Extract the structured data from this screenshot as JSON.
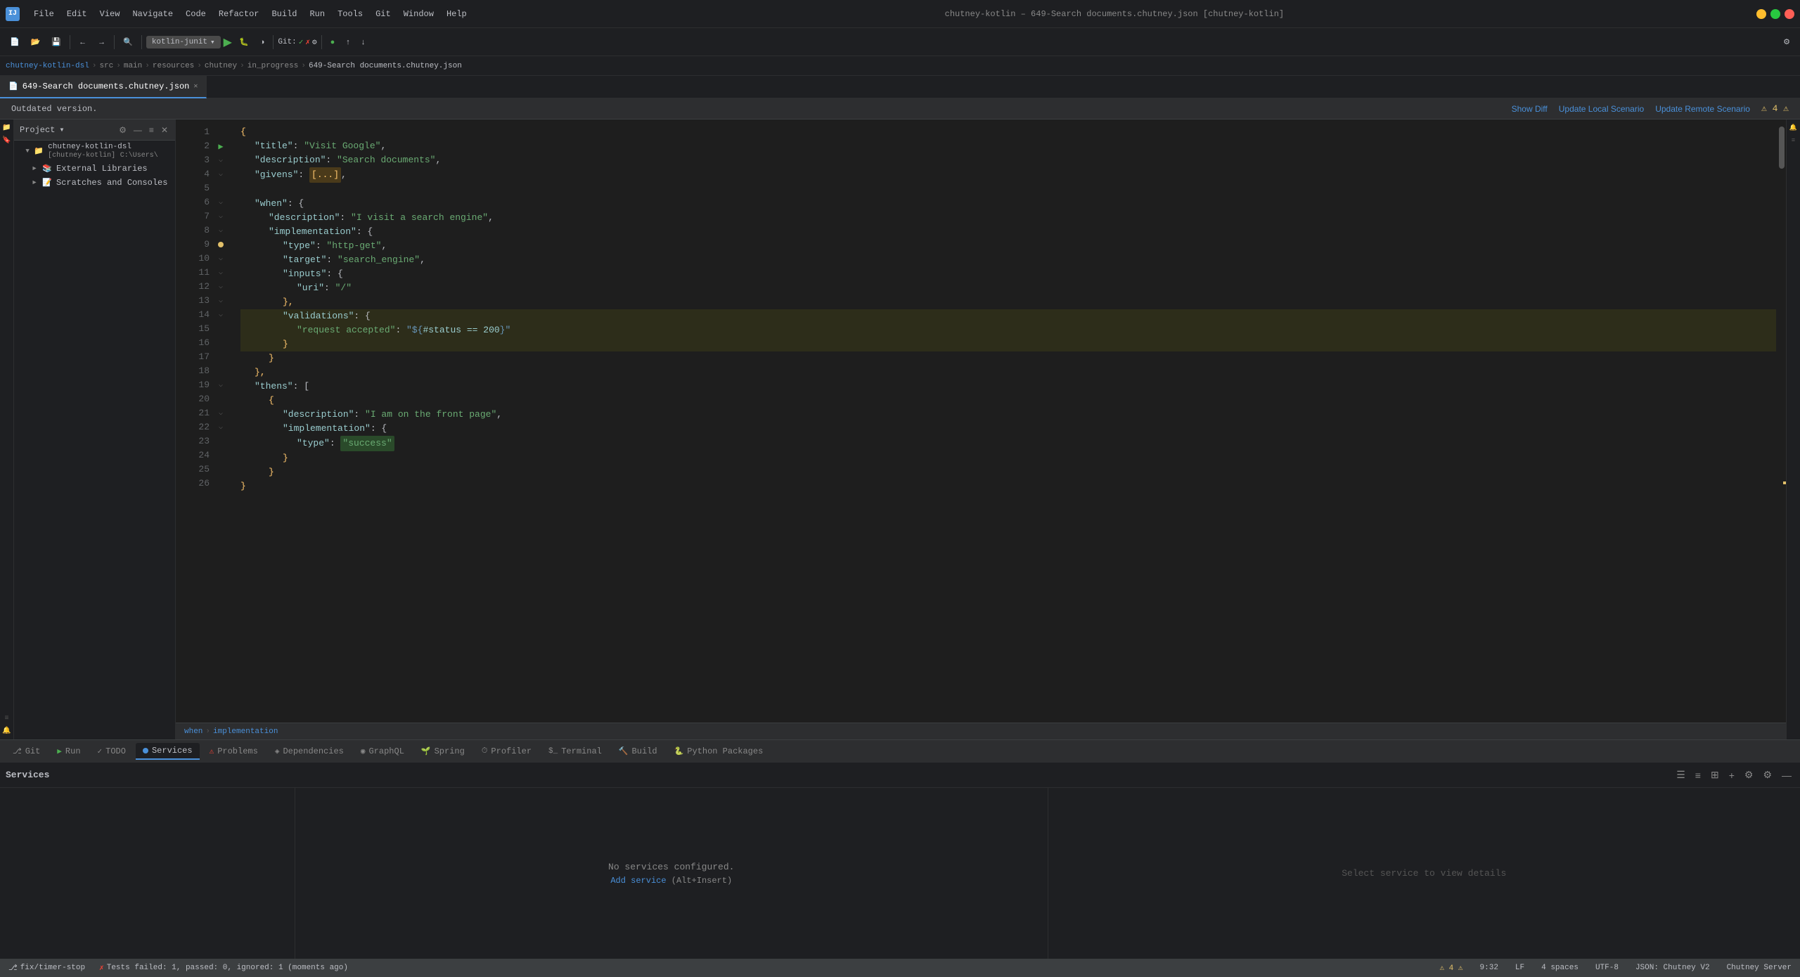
{
  "app": {
    "title": "chutney-kotlin – 649-Search documents.chutney.json [chutney-kotlin]",
    "icon_label": "IJ"
  },
  "title_bar": {
    "menu_items": [
      "File",
      "Edit",
      "View",
      "Navigate",
      "Code",
      "Refactor",
      "Build",
      "Run",
      "Tools",
      "Git",
      "Window",
      "Help"
    ]
  },
  "toolbar": {
    "project_dropdown": "chutney-kotlin-dsl",
    "run_config": "kotlin-junit",
    "git_label": "Git:",
    "git_check": "✓",
    "git_x": "✗"
  },
  "breadcrumb": {
    "parts": [
      "chutney-kotlin-dsl",
      "src",
      "main",
      "resources",
      "chutney",
      "in_progress",
      "649-Search documents.chutney.json"
    ]
  },
  "tabs": {
    "active": "649-Search documents.chutney.json"
  },
  "outdated_banner": {
    "text": "Outdated version.",
    "show_diff": "Show Diff",
    "update_local": "Update Local Scenario",
    "update_remote": "Update Remote Scenario",
    "warning": "⚠ 4 ⚠"
  },
  "sidebar": {
    "header": "Project",
    "items": [
      {
        "label": "chutney-kotlin-dsl [chutney-kotlin]",
        "path": "C:\\Users\\"
      },
      {
        "label": "External Libraries"
      },
      {
        "label": "Scratches and Consoles"
      }
    ]
  },
  "editor": {
    "lines": [
      {
        "num": 1,
        "indent": 0,
        "content": [
          {
            "t": "brace",
            "v": "{"
          }
        ],
        "fold": false
      },
      {
        "num": 2,
        "indent": 1,
        "content": [
          {
            "t": "key",
            "v": "\"title\""
          },
          {
            "t": "default",
            "v": ": "
          },
          {
            "t": "str",
            "v": "\"Visit Google\""
          }
        ],
        "arrow": true
      },
      {
        "num": 3,
        "indent": 1,
        "content": [
          {
            "t": "key",
            "v": "\"description\""
          },
          {
            "t": "default",
            "v": ": "
          },
          {
            "t": "str",
            "v": "\"Search documents\""
          }
        ]
      },
      {
        "num": 4,
        "indent": 1,
        "content": [
          {
            "t": "key",
            "v": "\"givens\""
          },
          {
            "t": "default",
            "v": ": "
          },
          {
            "t": "dots",
            "v": "[...]"
          }
        ]
      },
      {
        "num": 5,
        "indent": 0,
        "content": []
      },
      {
        "num": 6,
        "indent": 1,
        "content": [
          {
            "t": "key",
            "v": "\"when\""
          },
          {
            "t": "default",
            "v": ": {"
          }
        ],
        "fold": true
      },
      {
        "num": 7,
        "indent": 2,
        "content": [
          {
            "t": "key",
            "v": "\"description\""
          },
          {
            "t": "default",
            "v": ": "
          },
          {
            "t": "str",
            "v": "\"I visit a search engine\""
          }
        ]
      },
      {
        "num": 8,
        "indent": 2,
        "content": [
          {
            "t": "key",
            "v": "\"implementation\""
          },
          {
            "t": "default",
            "v": ": {"
          }
        ],
        "fold": true
      },
      {
        "num": 9,
        "indent": 3,
        "content": [
          {
            "t": "key",
            "v": "\"type\""
          },
          {
            "t": "default",
            "v": ": "
          },
          {
            "t": "str",
            "v": "\"http-get\""
          }
        ],
        "dot": true
      },
      {
        "num": 10,
        "indent": 3,
        "content": [
          {
            "t": "key",
            "v": "\"target\""
          },
          {
            "t": "default",
            "v": ": "
          },
          {
            "t": "str",
            "v": "\"search_engine\""
          }
        ]
      },
      {
        "num": 11,
        "indent": 3,
        "content": [
          {
            "t": "key",
            "v": "\"inputs\""
          },
          {
            "t": "default",
            "v": ": {"
          }
        ],
        "fold": true
      },
      {
        "num": 12,
        "indent": 4,
        "content": [
          {
            "t": "key",
            "v": "\"uri\""
          },
          {
            "t": "default",
            "v": ": "
          },
          {
            "t": "str",
            "v": "\"/\""
          }
        ]
      },
      {
        "num": 13,
        "indent": 3,
        "content": [
          {
            "t": "brace",
            "v": "}"
          }
        ]
      },
      {
        "num": 14,
        "indent": 3,
        "content": [
          {
            "t": "key",
            "v": "\"validations\""
          },
          {
            "t": "default",
            "v": ": {"
          }
        ],
        "fold": true,
        "highlight": true
      },
      {
        "num": 15,
        "indent": 4,
        "content": [
          {
            "t": "str",
            "v": "\"request accepted\""
          },
          {
            "t": "default",
            "v": ": "
          },
          {
            "t": "template",
            "v": "\"${#status == 200}\""
          }
        ],
        "highlight": true
      },
      {
        "num": 16,
        "indent": 3,
        "content": [
          {
            "t": "brace",
            "v": "}"
          }
        ],
        "highlight": true
      },
      {
        "num": 17,
        "indent": 2,
        "content": [
          {
            "t": "brace",
            "v": "}"
          }
        ]
      },
      {
        "num": 18,
        "indent": 1,
        "content": [
          {
            "t": "brace",
            "v": "}"
          }
        ]
      },
      {
        "num": 19,
        "indent": 1,
        "content": [
          {
            "t": "key",
            "v": "\"thens\""
          },
          {
            "t": "default",
            "v": ": ["
          }
        ],
        "fold": true
      },
      {
        "num": 20,
        "indent": 2,
        "content": [
          {
            "t": "brace",
            "v": "{"
          }
        ]
      },
      {
        "num": 21,
        "indent": 3,
        "content": [
          {
            "t": "key",
            "v": "\"description\""
          },
          {
            "t": "default",
            "v": ": "
          },
          {
            "t": "str",
            "v": "\"I am on the front page\""
          }
        ]
      },
      {
        "num": 22,
        "indent": 3,
        "content": [
          {
            "t": "key",
            "v": "\"implementation\""
          },
          {
            "t": "default",
            "v": ": {"
          }
        ],
        "fold": true
      },
      {
        "num": 23,
        "indent": 4,
        "content": [
          {
            "t": "key",
            "v": "\"type\""
          },
          {
            "t": "default",
            "v": ": "
          },
          {
            "t": "success",
            "v": "\"success\""
          }
        ]
      },
      {
        "num": 24,
        "indent": 3,
        "content": [
          {
            "t": "brace",
            "v": "}"
          }
        ]
      },
      {
        "num": 25,
        "indent": 2,
        "content": [
          {
            "t": "brace",
            "v": "}"
          }
        ]
      },
      {
        "num": 26,
        "indent": 0,
        "content": [
          {
            "t": "brace",
            "v": "}"
          }
        ]
      }
    ]
  },
  "editor_breadcrumb": {
    "when": "when",
    "sep": "›",
    "implementation": "implementation"
  },
  "bottom_panel": {
    "title": "Services",
    "no_services_text": "No services configured.",
    "add_service_label": "Add service",
    "add_service_shortcut": "(Alt+Insert)",
    "select_service_text": "Select service to view details"
  },
  "bottom_tabs": [
    {
      "label": "Git",
      "icon": "git",
      "active": false
    },
    {
      "label": "Run",
      "icon": "run",
      "active": false
    },
    {
      "label": "TODO",
      "icon": "todo",
      "active": false
    },
    {
      "label": "Services",
      "icon": "services",
      "active": true
    },
    {
      "label": "Problems",
      "icon": "problems",
      "active": false
    },
    {
      "label": "Dependencies",
      "icon": "deps",
      "active": false
    },
    {
      "label": "GraphQL",
      "icon": "graphql",
      "active": false
    },
    {
      "label": "Spring",
      "icon": "spring",
      "active": false
    },
    {
      "label": "Profiler",
      "icon": "profiler",
      "active": false
    },
    {
      "label": "Terminal",
      "icon": "terminal",
      "active": false
    },
    {
      "label": "Build",
      "icon": "build",
      "active": false
    },
    {
      "label": "Python Packages",
      "icon": "python",
      "active": false
    }
  ],
  "status_bar": {
    "time": "9:32",
    "line_col": "LF",
    "encoding": "UTF-8",
    "spaces": "4 spaces ✓",
    "file_type": "JSON: Chutney V2",
    "line_sep": "LF",
    "encoding_full": "UTF-8",
    "branch": "fix/timer-stop",
    "server": "Chutney Server",
    "test_status": "Tests failed: 1, passed: 0, ignored: 1 (moments ago)",
    "warnings": "⚠ 4 ⚠",
    "git_icon": "⎇",
    "indent": "4 spaces"
  }
}
